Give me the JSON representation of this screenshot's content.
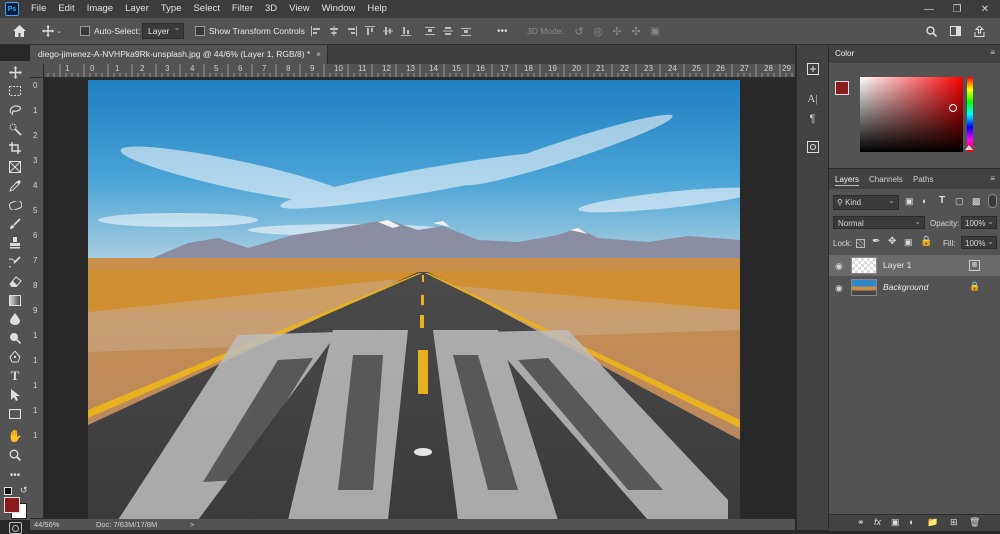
{
  "menu": [
    "File",
    "Edit",
    "Image",
    "Layer",
    "Type",
    "Select",
    "Filter",
    "3D",
    "View",
    "Window",
    "Help"
  ],
  "window_controls": {
    "minimize": "—",
    "restore": "❐",
    "close": "✕"
  },
  "options": {
    "auto_select_label": "Auto-Select:",
    "auto_select_value": "Layer",
    "transform_label": "Show Transform Controls",
    "mode_3d_label": "3D Mode:",
    "more_label": "•••"
  },
  "document": {
    "tab_title": "diego-jimenez-A-NVHPka9Rk-unsplash.jpg @ 44/6% (Layer 1, RGB/8) *",
    "close": "×"
  },
  "ruler": {
    "h_ticks": [
      "2",
      "1",
      "0",
      "1",
      "2",
      "3",
      "4",
      "5",
      "6",
      "7",
      "8",
      "9",
      "10",
      "11",
      "12",
      "13",
      "14",
      "15",
      "16",
      "17",
      "18",
      "19",
      "20",
      "21",
      "22",
      "23",
      "24",
      "25",
      "26",
      "27",
      "28",
      "29"
    ],
    "v_ticks": [
      "0",
      "1",
      "2",
      "3",
      "4",
      "5",
      "6",
      "7",
      "8",
      "9",
      "1",
      "1",
      "1",
      "1",
      "1"
    ]
  },
  "status": {
    "zoom": "44/56%",
    "doc": "Doc: 7/63M/17/8M",
    "arrow": ">"
  },
  "panels": {
    "color_tab": "Color",
    "layers_tabs": [
      "Layers",
      "Channels",
      "Paths"
    ],
    "filter_kind": "Kind",
    "blend_mode": "Normal",
    "opacity_label": "Opacity:",
    "opacity_value": "100%",
    "lock_label": "Lock:",
    "fill_label": "Fill:",
    "fill_value": "100%",
    "layers": [
      {
        "name": "Layer 1"
      },
      {
        "name": "Background"
      }
    ]
  },
  "colors": {
    "foreground": "#8b1a1a",
    "background": "#ffffff",
    "accent": "#31a8ff"
  }
}
